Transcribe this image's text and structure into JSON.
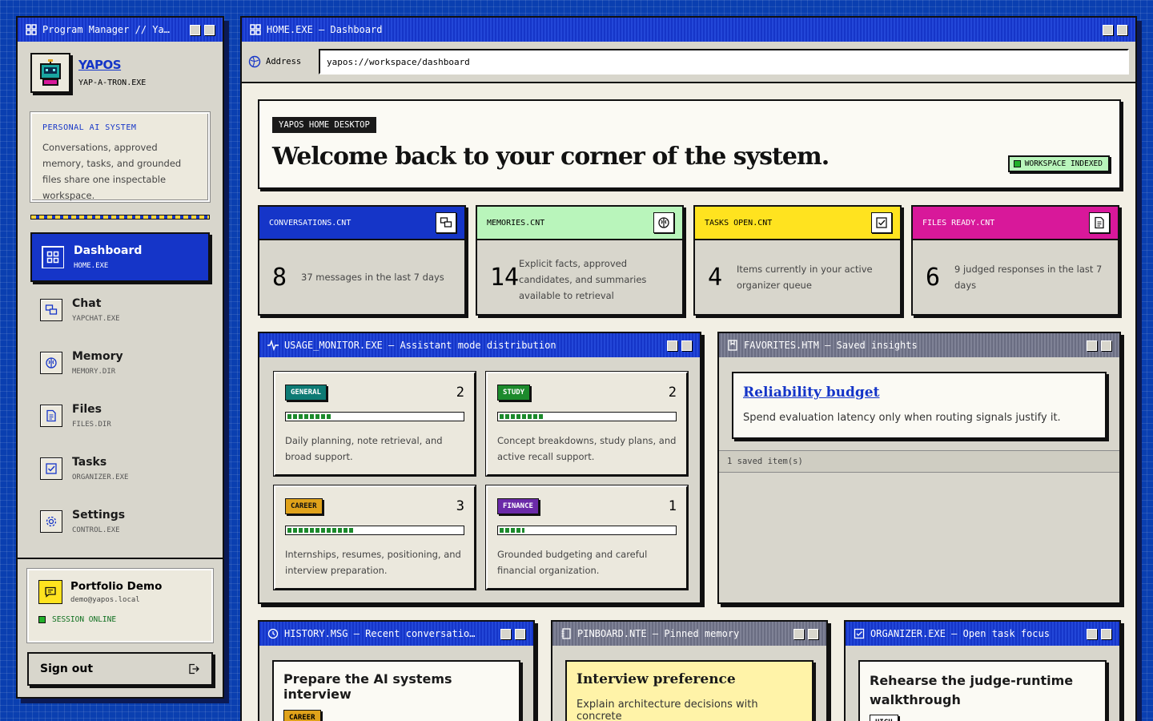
{
  "sidebar": {
    "title": "Program Manager // Ya…",
    "brand_name": "YAPOS",
    "brand_sub": "YAP-A-TRON.EXE",
    "info_label": "PERSONAL AI SYSTEM",
    "info_text": "Conversations, approved memory, tasks, and grounded files share one inspectable workspace.",
    "nav": [
      {
        "label": "Dashboard",
        "sub": "HOME.EXE",
        "icon": "dashboard-icon",
        "active": true
      },
      {
        "label": "Chat",
        "sub": "YAPCHAT.EXE",
        "icon": "chat-icon"
      },
      {
        "label": "Memory",
        "sub": "MEMORY.DIR",
        "icon": "brain-icon"
      },
      {
        "label": "Files",
        "sub": "FILES.DIR",
        "icon": "file-icon"
      },
      {
        "label": "Tasks",
        "sub": "ORGANIZER.EXE",
        "icon": "checkbox-icon"
      },
      {
        "label": "Settings",
        "sub": "CONTROL.EXE",
        "icon": "gear-icon"
      }
    ],
    "user": {
      "name": "Portfolio Demo",
      "email": "demo@yapos.local",
      "status": "SESSION ONLINE"
    },
    "signout_label": "Sign out"
  },
  "main": {
    "title": "HOME.EXE — Dashboard",
    "address_label": "Address",
    "address_value": "yapos://workspace/dashboard",
    "welcome_tag": "YAPOS HOME DESKTOP",
    "welcome_title": "Welcome back to your corner of the system.",
    "welcome_badge": "WORKSPACE INDEXED",
    "stats": [
      {
        "label": "CONVERSATIONS.CNT",
        "value": "8",
        "desc": "37 messages in the last 7 days",
        "color": "#1535c8",
        "icon": "chat-icon"
      },
      {
        "label": "MEMORIES.CNT",
        "value": "14",
        "desc": "Explicit facts, approved candidates, and summaries available to retrieval",
        "color": "#b9f5bb",
        "icon": "brain-icon"
      },
      {
        "label": "TASKS OPEN.CNT",
        "value": "4",
        "desc": "Items currently in your active organizer queue",
        "color": "#ffe31f",
        "icon": "checkbox-icon"
      },
      {
        "label": "FILES READY.CNT",
        "value": "6",
        "desc": "9 judged responses in the last 7 days",
        "color": "#d8189a",
        "icon": "file-icon"
      }
    ],
    "usage": {
      "title": "USAGE_MONITOR.EXE — Assistant mode distribution",
      "modes": [
        {
          "tag": "GENERAL",
          "count": "2",
          "fill": 0.25,
          "desc": "Daily planning, note retrieval, and broad support.",
          "color": "#0d7a74"
        },
        {
          "tag": "STUDY",
          "count": "2",
          "fill": 0.25,
          "desc": "Concept breakdowns, study plans, and active recall support.",
          "color": "#1c8a2c"
        },
        {
          "tag": "CAREER",
          "count": "3",
          "fill": 0.375,
          "desc": "Internships, resumes, positioning, and interview preparation.",
          "color": "#e0a21a"
        },
        {
          "tag": "FINANCE",
          "count": "1",
          "fill": 0.14,
          "desc": "Grounded budgeting and careful financial organization.",
          "color": "#6b2aa8"
        }
      ]
    },
    "favorites": {
      "title": "FAVORITES.HTM — Saved insights",
      "item_title": "Reliability budget",
      "item_desc": "Spend evaluation latency only when routing signals justify it.",
      "footer": "1 saved item(s)"
    },
    "history": {
      "title": "HISTORY.MSG — Recent conversatio…",
      "item_title": "Prepare the AI systems interview",
      "item_tag": "CAREER"
    },
    "pinboard": {
      "title": "PINBOARD.NTE — Pinned memory",
      "item_title": "Interview preference",
      "item_desc": "Explain architecture decisions with concrete"
    },
    "organizer": {
      "title": "ORGANIZER.EXE — Open task focus",
      "item_title": "Rehearse the judge-runtime walkthrough",
      "item_tag": "HIGH"
    }
  }
}
